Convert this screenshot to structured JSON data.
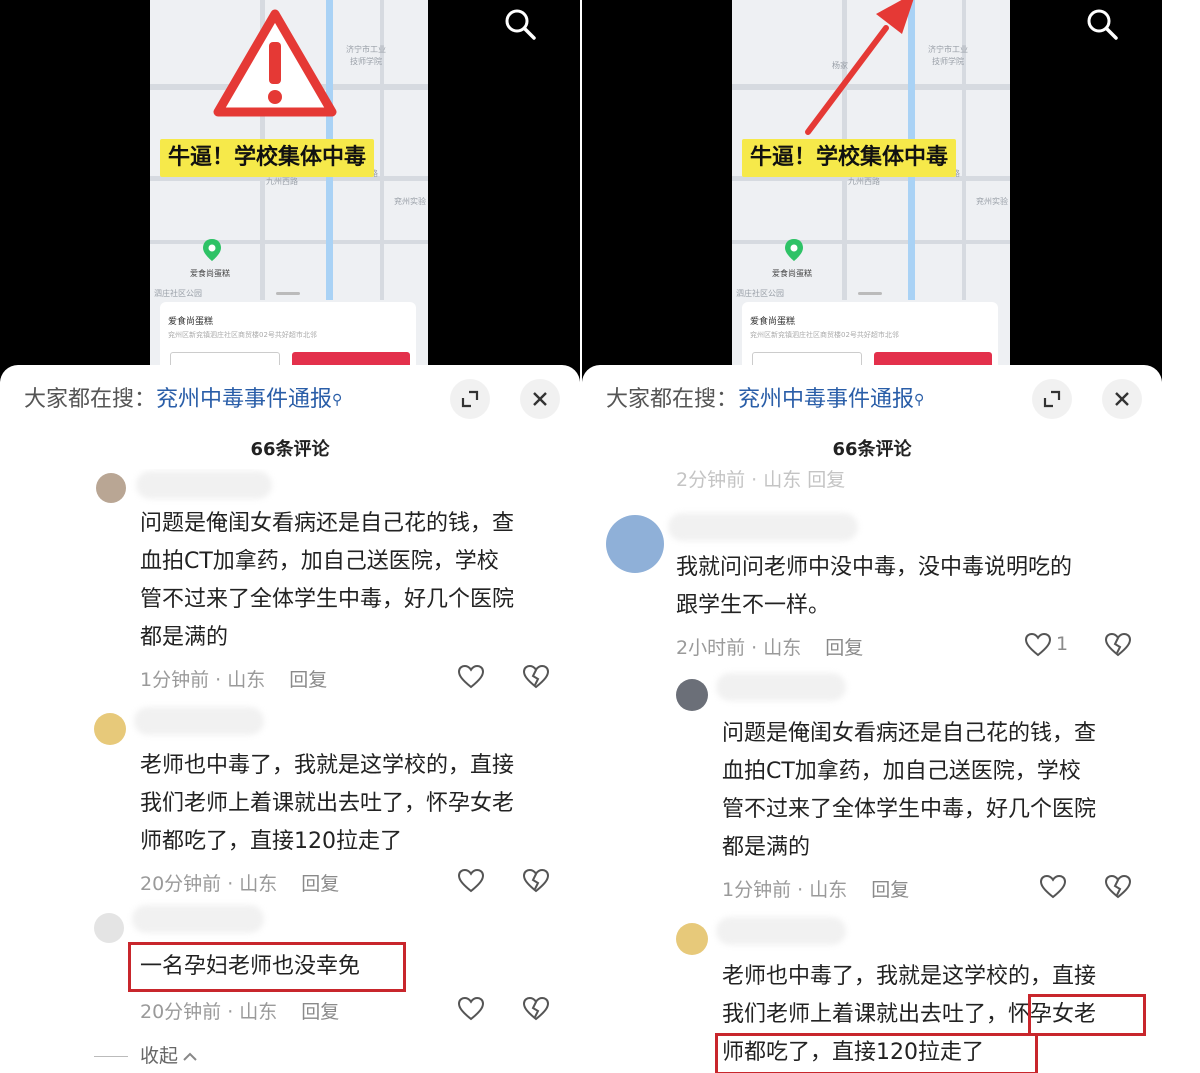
{
  "video": {
    "banner_text": "牛逼！学校集体中毒",
    "map_labels": [
      "济宁市工业",
      "技师学院",
      "九州西路",
      "九州中路",
      "兖州实验",
      "青州路",
      "爱食尚蛋糕",
      "泗庄社区公园",
      "杨家"
    ],
    "place_title": "爱食尚蛋糕",
    "place_address": "兖州区新兖镇泗庄社区商贸楼02号共好超市北邻"
  },
  "hot_search": {
    "prefix": "大家都在搜：",
    "link": "兖州中毒事件通报",
    "mag": "⚲"
  },
  "comment_count": "66条评论",
  "left": {
    "comments": [
      {
        "lines": [
          "问题是俺闺女看病还是自己花的钱，查",
          "血拍CT加拿药，加自己送医院，学校",
          "管不过来了全体学生中毒，好几个医院",
          "都是满的"
        ],
        "time_loc": "1分钟前 · 山东",
        "reply": "回复"
      },
      {
        "lines": [
          "老师也中毒了，我就是这学校的，直接",
          "我们老师上着课就出去吐了，怀孕女老",
          "师都吃了，直接120拉走了"
        ],
        "time_loc": "20分钟前 · 山东",
        "reply": "回复"
      },
      {
        "lines": [
          "一名孕妇老师也没幸免"
        ],
        "time_loc": "20分钟前 · 山东",
        "reply": "回复"
      }
    ],
    "collapse": "收起"
  },
  "right": {
    "faded_meta": "2分钟前 · 山东      回复",
    "comments": [
      {
        "lines": [
          "我就问问老师中没中毒，没中毒说明吃的",
          "跟学生不一样。"
        ],
        "time_loc": "2小时前 · 山东",
        "reply": "回复",
        "likes": "1"
      },
      {
        "lines": [
          "问题是俺闺女看病还是自己花的钱，查",
          "血拍CT加拿药，加自己送医院，学校",
          "管不过来了全体学生中毒，好几个医院",
          "都是满的"
        ],
        "time_loc": "1分钟前 · 山东",
        "reply": "回复"
      },
      {
        "lines": [
          "老师也中毒了，我就是这学校的，直接",
          "我们老师上着课就出去吐了，怀孕女老",
          "师都吃了，直接120拉走了"
        ]
      }
    ]
  },
  "colors": {
    "highlight_box": "#c8262c",
    "banner": "#f6e94a",
    "link": "#2a5ea8",
    "warning": "#e53935"
  }
}
